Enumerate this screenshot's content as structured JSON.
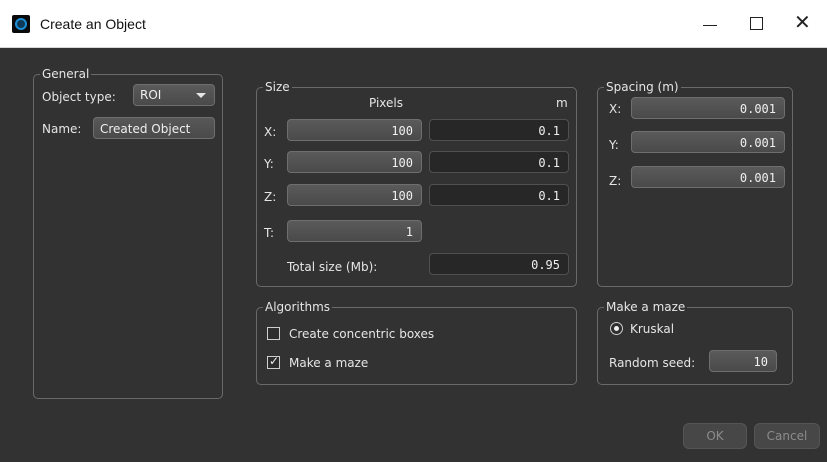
{
  "window": {
    "title": "Create an Object",
    "minimize_glyph": "—",
    "maximize_glyph": "☐",
    "close_glyph": "✕"
  },
  "general": {
    "group_title": "General",
    "object_type_label": "Object type:",
    "object_type_value": "ROI",
    "name_label": "Name:",
    "name_value": "Created Object"
  },
  "size": {
    "group_title": "Size",
    "pixels_header": "Pixels",
    "m_header": "m",
    "rows": [
      {
        "label": "X:",
        "pixels": "100",
        "m": "0.1"
      },
      {
        "label": "Y:",
        "pixels": "100",
        "m": "0.1"
      },
      {
        "label": "Z:",
        "pixels": "100",
        "m": "0.1"
      },
      {
        "label": "T:",
        "pixels": "1"
      }
    ],
    "total_label": "Total size (Mb):",
    "total_value": "0.95"
  },
  "spacing": {
    "group_title": "Spacing (m)",
    "rows": [
      {
        "label": "X:",
        "value": "0.001"
      },
      {
        "label": "Y:",
        "value": "0.001"
      },
      {
        "label": "Z:",
        "value": "0.001"
      }
    ]
  },
  "algorithms": {
    "group_title": "Algorithms",
    "options": [
      {
        "label": "Create concentric boxes",
        "checked": false
      },
      {
        "label": "Make a maze",
        "checked": true
      }
    ]
  },
  "maze": {
    "group_title": "Make a maze",
    "method_label": "Kruskal",
    "seed_label": "Random seed:",
    "seed_value": "10"
  },
  "buttons": {
    "ok": "OK",
    "cancel": "Cancel"
  }
}
